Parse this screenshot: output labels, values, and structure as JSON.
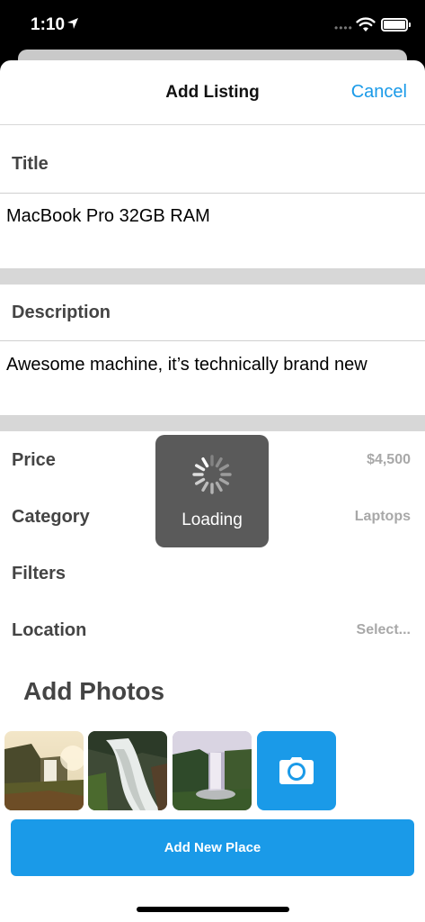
{
  "status_bar": {
    "time": "1:10"
  },
  "nav": {
    "title": "Add Listing",
    "cancel_label": "Cancel"
  },
  "form": {
    "title_label": "Title",
    "title_value": "MacBook Pro 32GB RAM",
    "description_label": "Description",
    "description_value": "Awesome machine, it’s technically brand new",
    "rows": [
      {
        "label": "Price",
        "value": "$4,500"
      },
      {
        "label": "Category",
        "value": "Laptops"
      },
      {
        "label": "Filters",
        "value": ""
      },
      {
        "label": "Location",
        "value": "Select..."
      }
    ]
  },
  "photos": {
    "title": "Add Photos",
    "items": [
      "waterfall-photo-1",
      "waterfall-photo-2",
      "waterfall-photo-3"
    ],
    "camera_icon": "camera-icon"
  },
  "add_button_label": "Add New Place",
  "loading": {
    "text": "Loading"
  },
  "colors": {
    "accent": "#1a9ae8",
    "label": "#444444",
    "muted": "#a8a8a8",
    "band": "#d7d7d7",
    "hud": "#5a5a5a"
  }
}
